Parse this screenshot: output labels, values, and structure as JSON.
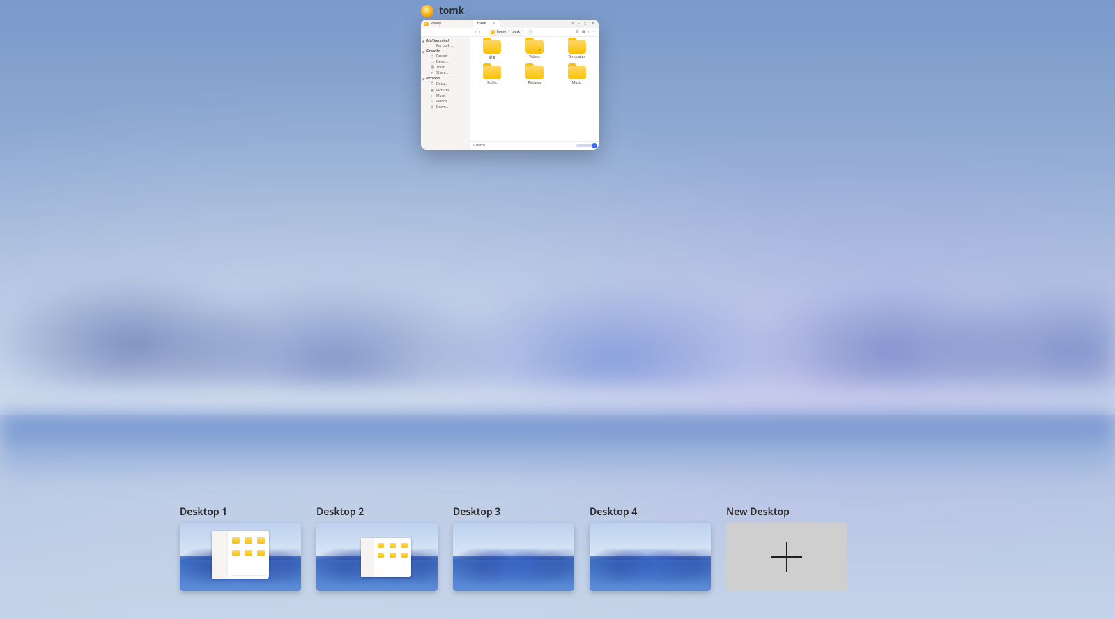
{
  "preview": {
    "title": "tomk"
  },
  "file_manager": {
    "app_name": "Peony",
    "tab": {
      "label": "tomk"
    },
    "window_controls": {
      "menu": "≡",
      "min": "–",
      "max": "▢",
      "close": "✕"
    },
    "toolbar": {
      "back": "‹",
      "forward": "›",
      "up": "↑",
      "search": "⌕",
      "view_list": "≣",
      "view_grid": "▦",
      "sort": "↕",
      "more": "⋯"
    },
    "breadcrumb": {
      "home_label": "home",
      "current": "tomk"
    },
    "sidebar": {
      "groups": [
        {
          "title": "Multiterminal",
          "items": [
            {
              "icon": "",
              "label": "For bulk …"
            }
          ]
        },
        {
          "title": "Favorite",
          "items": [
            {
              "icon": "◷",
              "label": "Recent"
            },
            {
              "icon": "▭",
              "label": "Deskt…"
            },
            {
              "icon": "🗑",
              "label": "Trash"
            },
            {
              "icon": "⇄",
              "label": "Share…"
            }
          ]
        },
        {
          "title": "Personal",
          "items": [
            {
              "icon": "🗎",
              "label": "Docu…"
            },
            {
              "icon": "▣",
              "label": "Pictures"
            },
            {
              "icon": "♪",
              "label": "Music"
            },
            {
              "icon": "▷",
              "label": "Videos"
            },
            {
              "icon": "⬇",
              "label": "Down…"
            }
          ]
        }
      ]
    },
    "folders": [
      {
        "name": "桌面",
        "glyph": ""
      },
      {
        "name": "Videos",
        "glyph": "▶"
      },
      {
        "name": "Templates",
        "glyph": ""
      },
      {
        "name": "Public",
        "glyph": "↗"
      },
      {
        "name": "Pictures",
        "glyph": ""
      },
      {
        "name": "Music",
        "glyph": "♪"
      }
    ],
    "status": {
      "count": "9 items"
    }
  },
  "switcher": {
    "desktops": [
      {
        "label": "Desktop 1",
        "has_window": true,
        "variant": "one"
      },
      {
        "label": "Desktop 2",
        "has_window": true,
        "variant": "two"
      },
      {
        "label": "Desktop 3",
        "has_window": false,
        "variant": ""
      },
      {
        "label": "Desktop 4",
        "has_window": false,
        "variant": ""
      }
    ],
    "new_label": "New Desktop"
  }
}
